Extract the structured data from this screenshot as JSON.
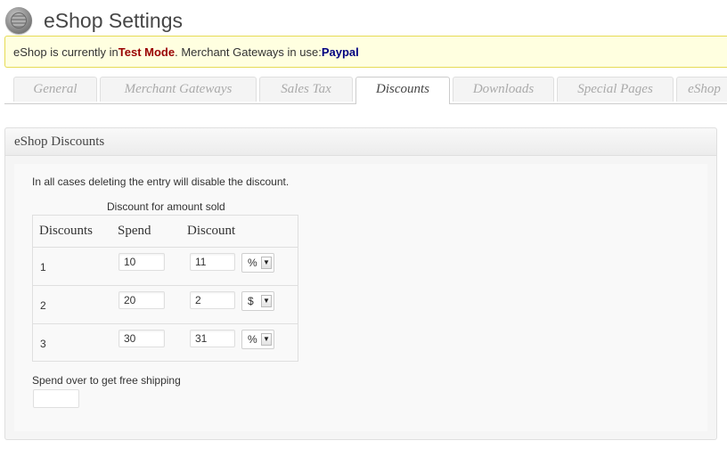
{
  "header": {
    "title": "eShop Settings",
    "logo_icon": "shopping-basket-logo-icon"
  },
  "notice": {
    "prefix": "eShop is currently in ",
    "mode": "Test Mode",
    "middle": ". Merchant Gateways in use: ",
    "gateway": "Paypal",
    "mode_color": "#990000",
    "gateway_color": "#000080"
  },
  "tabs": [
    {
      "label": "General",
      "active": false
    },
    {
      "label": "Merchant Gateways",
      "active": false
    },
    {
      "label": "Sales Tax",
      "active": false
    },
    {
      "label": "Discounts",
      "active": true
    },
    {
      "label": "Downloads",
      "active": false
    },
    {
      "label": "Special Pages",
      "active": false
    },
    {
      "label": "eShop",
      "active": false
    }
  ],
  "panel": {
    "title": "eShop Discounts",
    "intro": "In all cases deleting the entry will disable the discount.",
    "table_caption": "Discount for amount sold",
    "columns": [
      "Discounts",
      "Spend",
      "Discount"
    ],
    "rows": [
      {
        "num": "1",
        "spend": "10",
        "discount": "11",
        "type": "%"
      },
      {
        "num": "2",
        "spend": "20",
        "discount": "2",
        "type": "$"
      },
      {
        "num": "3",
        "spend": "30",
        "discount": "31",
        "type": "%"
      }
    ],
    "free_shipping_label": "Spend over to get free shipping",
    "free_shipping_value": ""
  }
}
